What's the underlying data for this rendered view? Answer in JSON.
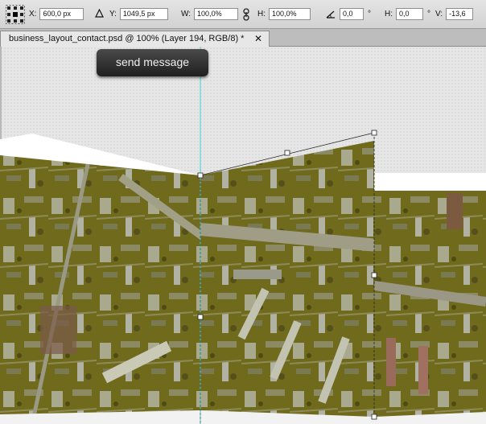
{
  "options_bar": {
    "x_label": "X:",
    "x_value": "600,0 px",
    "y_label": "Y:",
    "y_value": "1049,5 px",
    "w_label": "W:",
    "w_value": "100,0%",
    "h_label": "H:",
    "h_value": "100,0%",
    "angle_value": "0,0",
    "hskew_label": "H:",
    "hskew_value": "0,0",
    "vskew_label": "V:",
    "vskew_value": "-13,6",
    "degree_symbol": "°",
    "icons": [
      "reference-point-icon",
      "delta-icon",
      "link-icon",
      "angle-icon"
    ]
  },
  "tab": {
    "title": "business_layout_contact.psd @ 100% (Layer 194, RGB/8) *",
    "close": "✕"
  },
  "canvas": {
    "button_label": "send message"
  }
}
